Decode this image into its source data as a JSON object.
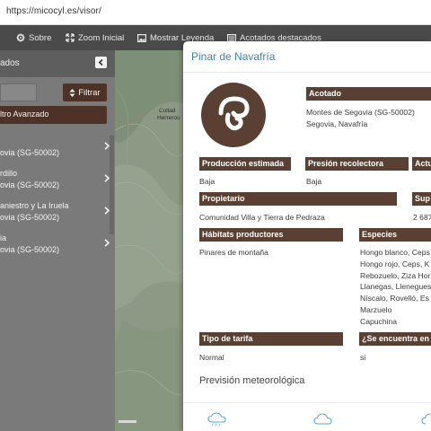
{
  "browser": {
    "url": "https://micocyl.es/visor/"
  },
  "toolbar": {
    "items": [
      {
        "label": "Sobre",
        "icon": "gear-icon"
      },
      {
        "label": "Zoom Inicial",
        "icon": "expand-icon"
      },
      {
        "label": "Mostrar Leyenda",
        "icon": "image-icon"
      },
      {
        "label": "Acotados destacados",
        "icon": "list-icon"
      }
    ]
  },
  "sidebar": {
    "title": "ados",
    "filter_label": "Filtrar",
    "advanced_label": "ltro Avanzado",
    "items": [
      {
        "line1": "",
        "line2": "ovia (SG-50002)"
      },
      {
        "line1": "rdillo",
        "line2": "ovia (SG-50002)"
      },
      {
        "line1": "aniestro y La Iruela",
        "line2": "ovia (SG-50002)"
      },
      {
        "line1": "ia",
        "line2": "ovia (SG-50002)"
      }
    ]
  },
  "map": {
    "place_label_1": "Collad",
    "place_label_2": "Herreros"
  },
  "panel": {
    "title": "Pinar de Navafría",
    "acotado": {
      "header": "Acotado",
      "line1": "Montes de Segovia (SG-50002)",
      "line2": "Segovia, Navafría"
    },
    "produccion": {
      "header": "Producción estimada",
      "value": "Baja"
    },
    "presion": {
      "header": "Presión recolectora",
      "value": "Baja"
    },
    "actividad": {
      "header": "Actu"
    },
    "propietario": {
      "header": "Propietario",
      "value": "Comunidad Villa y Tierra de Pedraza"
    },
    "superficie": {
      "header": "Sup",
      "value": "2 687"
    },
    "habitats": {
      "header": "Hábitats productores",
      "value": "Pinares de montaña"
    },
    "especies": {
      "header": "Especies",
      "lines": [
        "Hongo blanco, Ceps",
        "Hongo rojo, Ceps, K",
        "Rebozuelo, Ziza Hor",
        "Llanegas, Llenegues",
        "Níscalo, Rovelló, Es",
        "Marzuelo",
        "Capuchina"
      ]
    },
    "tarifa": {
      "header": "Tipo de tarifa",
      "value": "Normal"
    },
    "encuentra": {
      "header": "¿Se encuentra en l",
      "value": "si"
    },
    "forecast_title": "Previsión meteorológica"
  },
  "colors": {
    "header_brown": "#5a4033",
    "title_blue": "#3e83b5",
    "toolbar_dark": "#4a4a4a"
  }
}
